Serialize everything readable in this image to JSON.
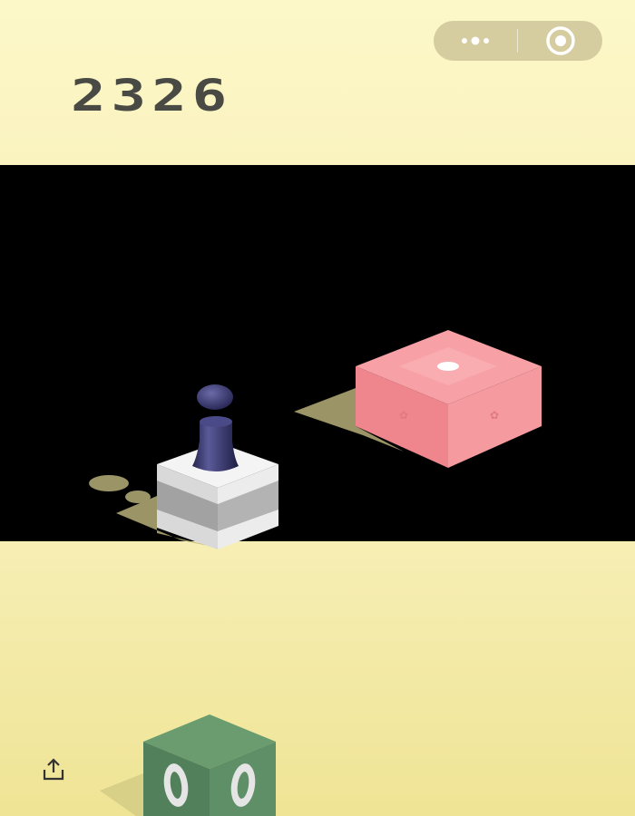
{
  "game": {
    "score": "2326"
  },
  "menu_capsule": {
    "menu_icon": "more-dots-icon",
    "close_icon": "target-circle-icon"
  },
  "share": {
    "icon": "share-upload-icon"
  },
  "colors": {
    "background_light": "#fdf8c8",
    "background_bottom": "#efe495",
    "platform_pink": "#f59a9f",
    "platform_white": "#f2f2f2",
    "platform_green": "#64956a",
    "player": "#2b2a5c",
    "score_text": "#4a4a45"
  }
}
